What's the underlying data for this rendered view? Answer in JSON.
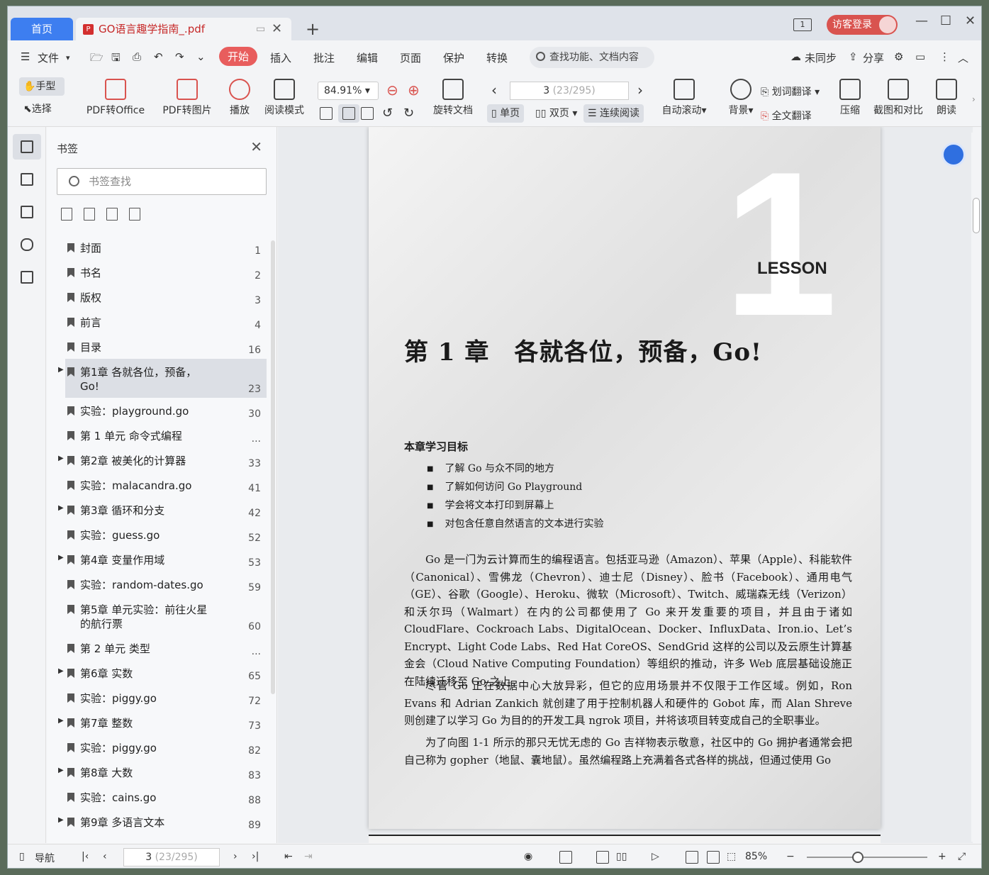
{
  "tabs": {
    "home": "首页",
    "doc": "GO语言趣学指南_.pdf"
  },
  "titlebar": {
    "pages_badge": "1",
    "login": "访客登录"
  },
  "menu": {
    "file": "文件",
    "items": [
      "开始",
      "插入",
      "批注",
      "编辑",
      "页面",
      "保护",
      "转换"
    ],
    "search": "查找功能、文档内容",
    "sync": "未同步",
    "share": "分享"
  },
  "toolbar": {
    "hand": "手型",
    "select": "选择",
    "pdf_to_office": "PDF转Office",
    "pdf_to_image": "PDF转图片",
    "play": "播放",
    "read_mode": "阅读模式",
    "zoom": "84.91%",
    "page_current": "3",
    "page_total": "(23/295)",
    "rotate": "旋转文档",
    "single": "单页",
    "double": "双页",
    "continuous": "连续阅读",
    "auto_scroll": "自动滚动",
    "background": "背景",
    "word_translate": "划词翻译",
    "full_translate": "全文翻译",
    "compress": "压缩",
    "screenshot": "截图和对比",
    "read_aloud": "朗读"
  },
  "bookmarks": {
    "title": "书签",
    "search_placeholder": "书签查找",
    "items": [
      {
        "label": "封面",
        "page": "1",
        "arrow": false
      },
      {
        "label": "书名",
        "page": "2",
        "arrow": false
      },
      {
        "label": "版权",
        "page": "3",
        "arrow": false
      },
      {
        "label": "前言",
        "page": "4",
        "arrow": false
      },
      {
        "label": "目录",
        "page": "16",
        "arrow": false
      },
      {
        "label": "第1章 各就各位，预备，Go!",
        "page": "23",
        "arrow": true,
        "selected": true,
        "tall": true
      },
      {
        "label": "实验：playground.go",
        "page": "30",
        "arrow": false
      },
      {
        "label": "第 1 单元 命令式编程",
        "page": "...",
        "arrow": false
      },
      {
        "label": "第2章 被美化的计算器",
        "page": "33",
        "arrow": true
      },
      {
        "label": "实验：malacandra.go",
        "page": "41",
        "arrow": false
      },
      {
        "label": "第3章 循环和分支",
        "page": "42",
        "arrow": true
      },
      {
        "label": "实验：guess.go",
        "page": "52",
        "arrow": false
      },
      {
        "label": "第4章 变量作用域",
        "page": "53",
        "arrow": true
      },
      {
        "label": "实验：random-dates.go",
        "page": "59",
        "arrow": false
      },
      {
        "label": "第5章 单元实验：前往火星的航行票",
        "page": "60",
        "arrow": false,
        "tall": true
      },
      {
        "label": "第 2 单元 类型",
        "page": "...",
        "arrow": false
      },
      {
        "label": "第6章 实数",
        "page": "65",
        "arrow": true
      },
      {
        "label": "实验：piggy.go",
        "page": "72",
        "arrow": false
      },
      {
        "label": "第7章 整数",
        "page": "73",
        "arrow": true
      },
      {
        "label": "实验：piggy.go",
        "page": "82",
        "arrow": false
      },
      {
        "label": "第8章 大数",
        "page": "83",
        "arrow": true
      },
      {
        "label": "实验：cains.go",
        "page": "88",
        "arrow": false
      },
      {
        "label": "第9章 多语言文本",
        "page": "89",
        "arrow": true
      }
    ]
  },
  "document": {
    "big_number": "1",
    "lesson": "LESSON",
    "chapter_title": "第 1 章　各就各位，预备，Go!",
    "goals_heading": "本章学习目标",
    "goals": [
      "了解 Go 与众不同的地方",
      "了解如何访问 Go Playground",
      "学会将文本打印到屏幕上",
      "对包含任意自然语言的文本进行实验"
    ],
    "para1": "Go 是一门为云计算而生的编程语言。包括亚马逊（Amazon）、苹果（Apple）、科能软件（Canonical）、雪佛龙（Chevron）、迪士尼（Disney）、脸书（Facebook）、通用电气（GE）、谷歌（Google）、Heroku、微软（Microsoft）、Twitch、威瑞森无线（Verizon）和沃尔玛（Walmart）在内的公司都使用了 Go 来开发重要的项目，并且由于诸如 CloudFlare、Cockroach Labs、DigitalOcean、Docker、InfluxData、Iron.io、Let’s Encrypt、Light Code Labs、Red Hat CoreOS、SendGrid 这样的公司以及云原生计算基金会（Cloud Native Computing Foundation）等组织的推动，许多 Web 底层基础设施正在陆续迁移至 Go 之上。",
    "para2": "尽管 Go 正在数据中心大放异彩，但它的应用场景并不仅限于工作区域。例如，Ron Evans 和 Adrian Zankich 就创建了用于控制机器人和硬件的 Gobot 库，而 Alan Shreve 则创建了以学习 Go 为目的的开发工具 ngrok 项目，并将该项目转变成自己的全职事业。",
    "para3": "为了向图 1-1 所示的那只无忧无虑的 Go 吉祥物表示敬意，社区中的 Go 拥护者通常会把自己称为 gopher（地鼠、囊地鼠）。虽然编程路上充满着各式各样的挑战，但通过使用 Go"
  },
  "status": {
    "nav": "导航",
    "page_current": "3",
    "page_total": "(23/295)",
    "zoom": "85%"
  }
}
